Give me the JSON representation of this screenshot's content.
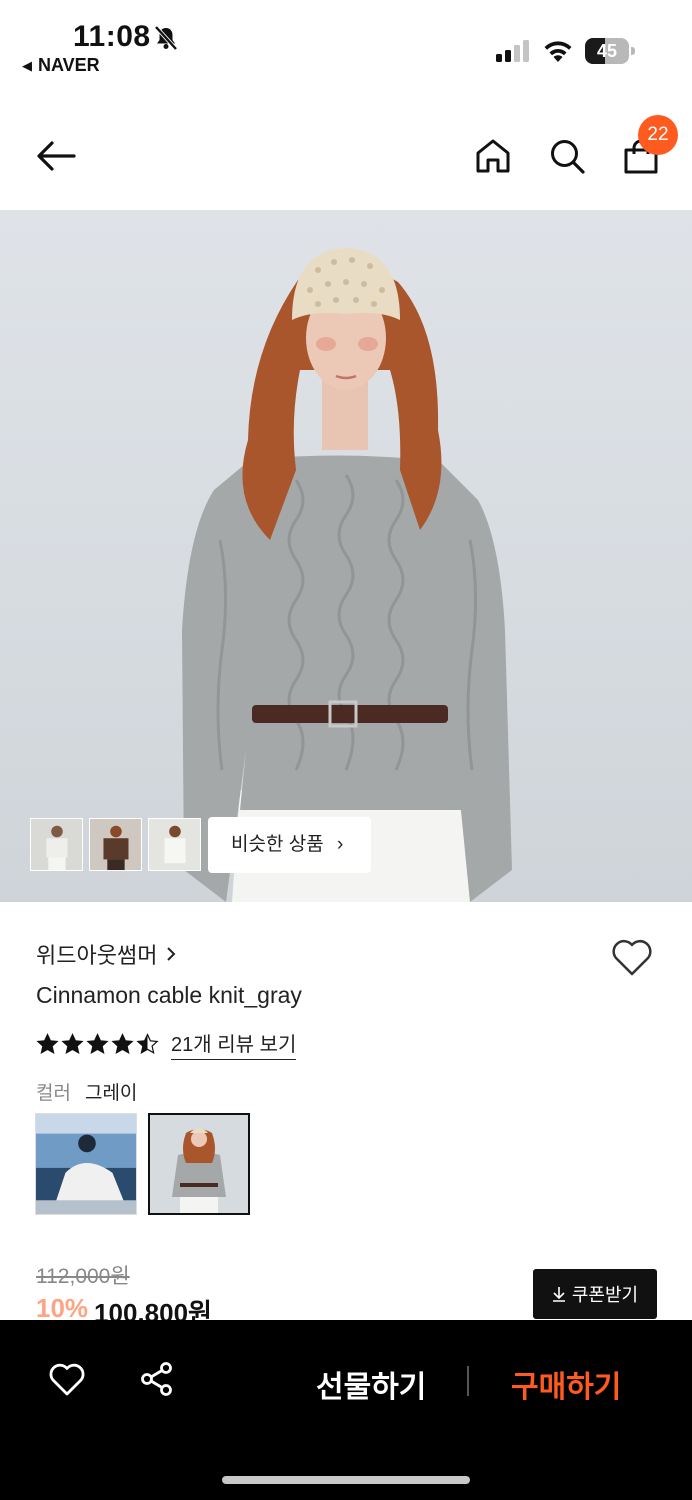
{
  "status_bar": {
    "time": "11:08",
    "back_app": "NAVER",
    "battery": "45",
    "battery_level": 0.45
  },
  "nav": {
    "cart_count": "22"
  },
  "hero": {
    "similar_button": "비슷한 상품"
  },
  "product": {
    "brand": "위드아웃썸머",
    "name": "Cinnamon cable knit_gray",
    "rating": 4.5,
    "review_link": "21개 리뷰 보기",
    "color_label": "컬러",
    "color_value": "그레이",
    "original_price": "112,000원",
    "discount": "10%",
    "sale_price": "100,800원",
    "coupon_button": "쿠폰받기"
  },
  "bottom_bar": {
    "gift_label": "선물하기",
    "buy_label": "구매하기"
  },
  "colors": {
    "accent": "#ff5a1f",
    "bottom_bar_bg": "#000000"
  }
}
